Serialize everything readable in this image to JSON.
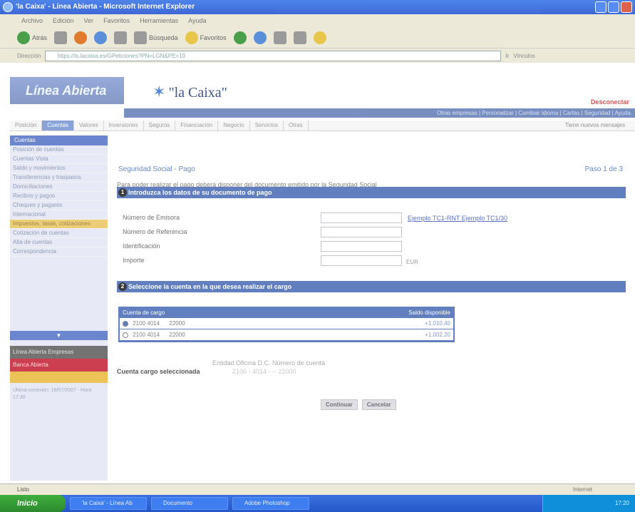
{
  "window": {
    "title": "'la Caixa' - Línea Abierta - Microsoft Internet Explorer"
  },
  "menubar": {
    "items": [
      "Archivo",
      "Edición",
      "Ver",
      "Favoritos",
      "Herramientas",
      "Ayuda"
    ]
  },
  "toolbar": {
    "back": "Atrás",
    "search": "Búsqueda",
    "favorites": "Favoritos"
  },
  "address": {
    "label": "Dirección",
    "url": "https://lo.lacaixa.es/GPeticiones?PN=LGN&PE=10",
    "go": "Ir",
    "links": "Vínculos"
  },
  "site": {
    "brand": "Línea Abierta",
    "bank": "\"la Caixa\"",
    "exit": "Desconectar",
    "toplinks": "Otras empresas | Personalizar | Cambiar idioma | Cartas | Seguridad | Ayuda"
  },
  "tabs": {
    "items": [
      "Posición",
      "Cuentas",
      "Valores",
      "Inversiones",
      "Seguros",
      "Financiación",
      "Negocio",
      "Servicios",
      "Otras"
    ],
    "active_index": 1,
    "right_note": "Tiene nuevos mensajes"
  },
  "leftnav": {
    "head": "Cuentas",
    "items": [
      "Posición de cuentas",
      "Cuentas Vista",
      "Saldo y movimientos",
      "Transferencias y traspasos",
      "Domiciliaciones",
      "Recibos y pagos",
      "Cheques y pagarés",
      "Internacional",
      "Impuestos, tasas, cotizaciones",
      "Cotización de cuentas",
      "Alta de cuentas",
      "Correspondencia"
    ],
    "highlight_index": 8,
    "band": "▼",
    "promo1": "Línea Abierta Empresas",
    "promo2": "Banca Abierta",
    "footer": "Última conexión: 16/07/2007 - Hora 17:30"
  },
  "main": {
    "breadcrumb": "Seguridad Social - Pago",
    "step": "Paso 1 de 3",
    "intro": "Para poder realizar el pago deberá disponer del documento emitido por la Seguridad Social",
    "section1": {
      "num": "1",
      "title": "Introduzca los datos de su documento de pago"
    },
    "fields": [
      {
        "label": "Número de Emisora",
        "value": ""
      },
      {
        "label": "Número de Referencia",
        "value": ""
      },
      {
        "label": "Identificación",
        "value": ""
      },
      {
        "label": "Importe",
        "value": ""
      }
    ],
    "links": "Ejemplo TC1-RNT   Ejemplo TC1/30",
    "currency": "EUR",
    "section2": {
      "num": "2",
      "title": "Seleccione la cuenta en la que desea realizar el cargo"
    },
    "table": {
      "col_account": "Cuenta de cargo",
      "col_balance": "Saldo disponible",
      "rows": [
        {
          "entity": "2100 4014",
          "account": "22000",
          "balance": "+1.010,40",
          "selected": true
        },
        {
          "entity": "2100 4014",
          "account": "22000",
          "balance": "+1.002,20",
          "selected": false
        }
      ]
    },
    "entity_labels": "Entidad Oficina  D.C. Número de cuenta",
    "selected_account_label": "Cuenta cargo seleccionada",
    "selected_account_value": "2100 - 4014 - -- 22000",
    "buttons": {
      "continue": "Continuar",
      "cancel": "Cancelar"
    }
  },
  "statusbar": {
    "text": "Listo",
    "zone": "Internet"
  },
  "taskbar": {
    "start": "Inicio",
    "tasks": [
      "'la Caixa' - Línea Ab",
      "Documento",
      "Adobe Photoshop"
    ],
    "tray": "17:20"
  }
}
